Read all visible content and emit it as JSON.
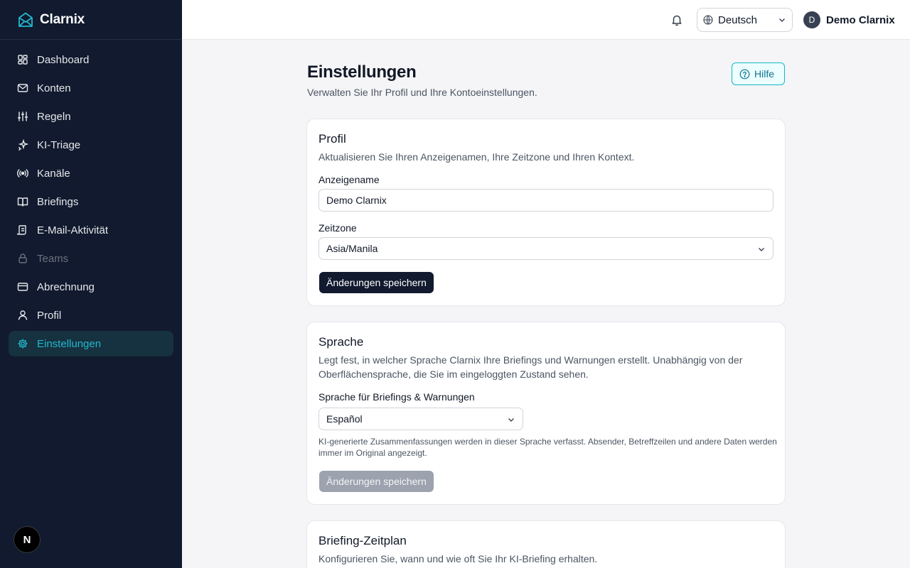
{
  "app": {
    "name": "Clarnix"
  },
  "sidebar": {
    "items": [
      {
        "label": "Dashboard",
        "icon": "dashboard-icon"
      },
      {
        "label": "Konten",
        "icon": "mail-icon"
      },
      {
        "label": "Regeln",
        "icon": "sliders-icon"
      },
      {
        "label": "KI-Triage",
        "icon": "sparkles-icon"
      },
      {
        "label": "Kanäle",
        "icon": "radio-icon"
      },
      {
        "label": "Briefings",
        "icon": "book-icon"
      },
      {
        "label": "E-Mail-Aktivität",
        "icon": "scroll-icon"
      },
      {
        "label": "Teams",
        "icon": "lock-icon",
        "disabled": true
      },
      {
        "label": "Abrechnung",
        "icon": "credit-card-icon"
      },
      {
        "label": "Profil",
        "icon": "user-icon"
      },
      {
        "label": "Einstellungen",
        "icon": "gear-icon",
        "active": true
      }
    ],
    "badge": "N"
  },
  "topbar": {
    "language": "Deutsch",
    "user": {
      "initial": "D",
      "name": "Demo Clarnix"
    }
  },
  "page": {
    "title": "Einstellungen",
    "subtitle": "Verwalten Sie Ihr Profil und Ihre Kontoeinstellungen.",
    "help_label": "Hilfe"
  },
  "profile_card": {
    "title": "Profil",
    "description": "Aktualisieren Sie Ihren Anzeigenamen, Ihre Zeitzone und Ihren Kontext.",
    "display_name_label": "Anzeigename",
    "display_name_value": "Demo Clarnix",
    "timezone_label": "Zeitzone",
    "timezone_value": "Asia/Manila",
    "save_label": "Änderungen speichern"
  },
  "language_card": {
    "title": "Sprache",
    "description": "Legt fest, in welcher Sprache Clarnix Ihre Briefings und Warnungen erstellt. Unabhängig von der Oberflächensprache, die Sie im eingeloggten Zustand sehen.",
    "select_label": "Sprache für Briefings & Warnungen",
    "select_value": "Español",
    "hint": "KI-generierte Zusammenfassungen werden in dieser Sprache verfasst. Absender, Betreffzeilen und andere Daten werden immer im Original angezeigt.",
    "save_label": "Änderungen speichern"
  },
  "schedule_card": {
    "title": "Briefing-Zeitplan",
    "description": "Konfigurieren Sie, wann und wie oft Sie Ihr KI-Briefing erhalten."
  },
  "colors": {
    "sidebar_bg": "#111a2e",
    "accent": "#22b8cf",
    "primary_button": "#111a2e"
  }
}
